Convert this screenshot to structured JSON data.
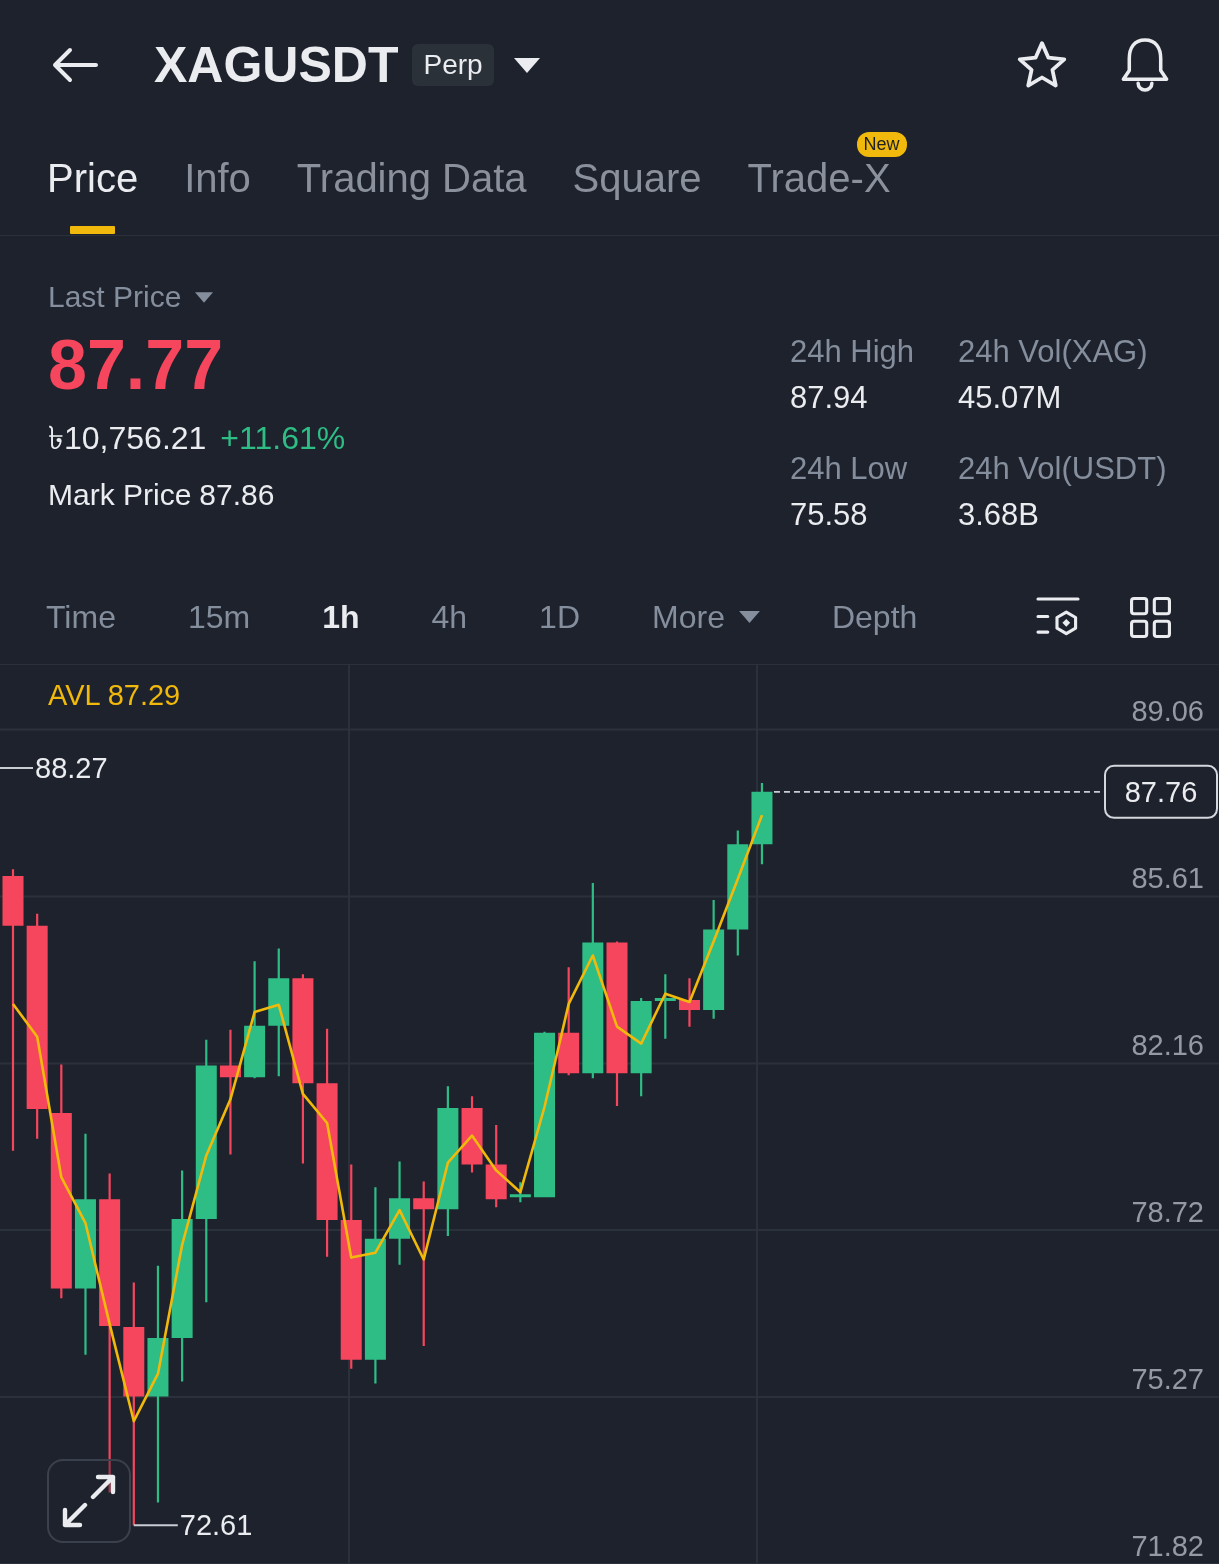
{
  "header": {
    "title": "XAGUSDT",
    "badge": "Perp"
  },
  "tabs": [
    {
      "label": "Price",
      "selected": true
    },
    {
      "label": "Info",
      "selected": false
    },
    {
      "label": "Trading Data",
      "selected": false
    },
    {
      "label": "Square",
      "selected": false
    },
    {
      "label": "Trade-X",
      "selected": false,
      "badge": "New"
    }
  ],
  "price_summary": {
    "label": "Last Price",
    "last_price": "87.77",
    "fiat_value": "৳10,756.21",
    "change": "+11.61%",
    "mark_price_label": "Mark Price",
    "mark_price": "87.86"
  },
  "stats": [
    {
      "label": "24h High",
      "value": "87.94"
    },
    {
      "label": "24h Vol(XAG)",
      "value": "45.07M"
    },
    {
      "label": "24h Low",
      "value": "75.58"
    },
    {
      "label": "24h Vol(USDT)",
      "value": "3.68B"
    }
  ],
  "intervals": [
    {
      "label": "Time",
      "kind": "option",
      "selected": false
    },
    {
      "label": "15m",
      "kind": "option",
      "selected": false
    },
    {
      "label": "1h",
      "kind": "option",
      "selected": true
    },
    {
      "label": "4h",
      "kind": "option",
      "selected": false
    },
    {
      "label": "1D",
      "kind": "option",
      "selected": false
    },
    {
      "label": "More",
      "kind": "dropdown",
      "selected": false
    },
    {
      "label": "Depth",
      "kind": "option",
      "selected": false
    }
  ],
  "chart": {
    "indicator_value": "87.29",
    "high_label": "88.27",
    "low_label": "72.61",
    "last_price_tag": "87.76",
    "chart_data": {
      "type": "line",
      "grid": true,
      "ylim": [
        71.82,
        90.39
      ],
      "yticks": [
        89.06,
        85.61,
        82.16,
        78.72,
        75.27,
        71.82
      ],
      "series": [
        {
          "name": "AVL",
          "color": "#f0b90b",
          "values": [
            83.39,
            82.71,
            79.81,
            78.86,
            76.78,
            74.77,
            75.75,
            78.41,
            80.26,
            81.42,
            83.22,
            83.37,
            81.53,
            80.93,
            78.15,
            78.25,
            79.13,
            78.11,
            80.11,
            80.67,
            79.95,
            79.5,
            81.26,
            83.39,
            84.39,
            82.92,
            82.57,
            83.6,
            83.43,
            84.68,
            85.97,
            87.29
          ]
        }
      ]
    }
  }
}
